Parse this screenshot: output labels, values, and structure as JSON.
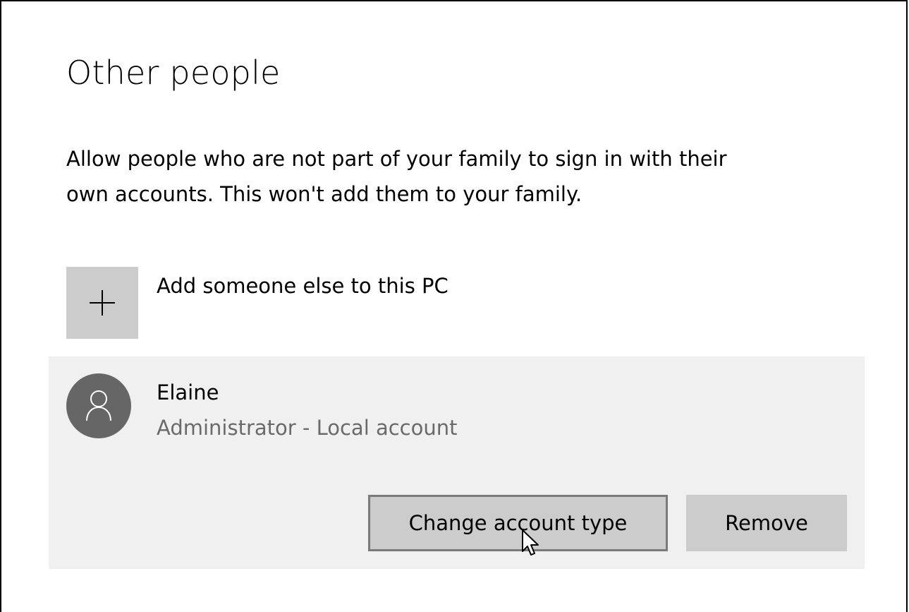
{
  "page": {
    "title": "Other people",
    "description_line1": "Allow people who are not part of your family to sign in with their",
    "description_line2": "own accounts. This won't add them to your family."
  },
  "add_person": {
    "icon": "plus-icon",
    "label": "Add someone else to this PC"
  },
  "account": {
    "avatar_icon": "person-icon",
    "name": "Elaine",
    "type": "Administrator - Local account",
    "buttons": {
      "change_type": "Change account type",
      "remove": "Remove"
    }
  },
  "colors": {
    "tile_gray": "#cccccc",
    "panel_gray": "#f0f0f0",
    "avatar_gray": "#666666",
    "secondary_text": "#6a6a6a"
  }
}
